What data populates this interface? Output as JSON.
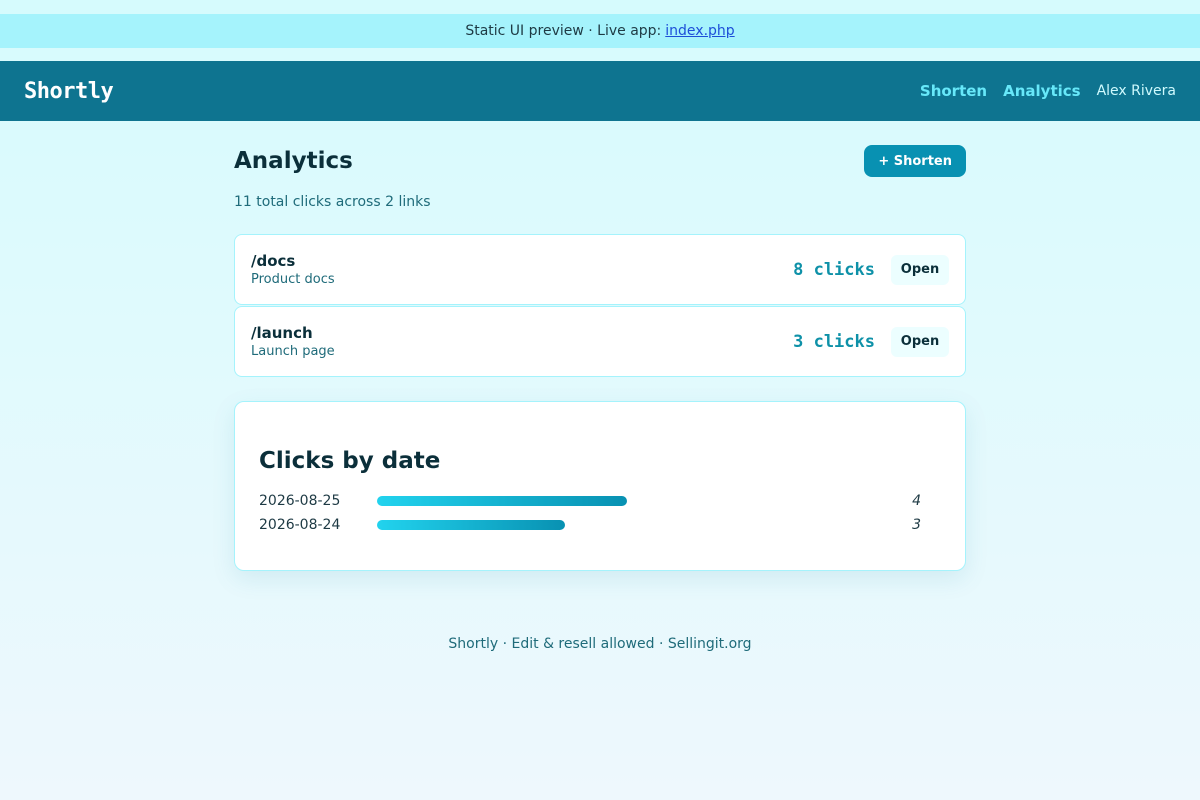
{
  "banner": {
    "text": "Static UI preview · Live app:",
    "link": "index.php"
  },
  "nav": {
    "brand": "Shortly",
    "links": [
      {
        "label": "Shorten"
      },
      {
        "label": "Analytics"
      }
    ],
    "user": "Alex Rivera"
  },
  "page": {
    "title": "Analytics",
    "shorten_button": "+ Shorten",
    "summary": "11 total clicks across 2 links"
  },
  "links": [
    {
      "slug": "/docs",
      "description": "Product docs",
      "clicks": "8 clicks",
      "open_label": "Open"
    },
    {
      "slug": "/launch",
      "description": "Launch page",
      "clicks": "3 clicks",
      "open_label": "Open"
    }
  ],
  "chart": {
    "title": "Clicks by date",
    "max_value": 8
  },
  "chart_data": {
    "type": "bar",
    "categories": [
      "2026-08-25",
      "2026-08-24"
    ],
    "values": [
      4,
      3
    ],
    "title": "Clicks by date",
    "xlabel": "",
    "ylabel": ""
  },
  "footer": {
    "text": "Shortly · Edit & resell allowed · Sellingit.org"
  },
  "colors": {
    "nav_bg": "#0e7490",
    "accent": "#0891b2",
    "banner_bg": "#a5f3fc"
  }
}
